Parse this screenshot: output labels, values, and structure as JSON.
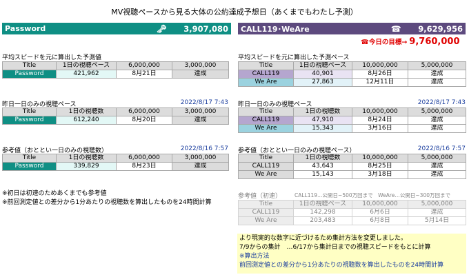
{
  "title": "MV視聴ペースから見る大体の公約達成予想日（あくまでもわたし予測）",
  "password_header": {
    "name": "Password",
    "icon": "🗝",
    "count": "3,907,080"
  },
  "call_header": {
    "name": "CALL119･WeAre",
    "icon": "☎",
    "count": "9,629,956"
  },
  "goal": {
    "label": "☎今日の目標→",
    "value": "9,760,000"
  },
  "left": {
    "avg": {
      "title": "平均スピードを元に算出した予測値",
      "columns": [
        "Title",
        "1日の視聴ペース",
        "6,000,000",
        "3,000,000"
      ],
      "rows": [
        {
          "label": "Password",
          "pace": "421,962",
          "d1": "8月21日",
          "d2": "達成"
        }
      ]
    },
    "yesterday": {
      "title": "昨日一日のみの視聴ペース",
      "date": "2022/8/17 7:43",
      "columns": [
        "Title",
        "1日の視聴数",
        "6,000,000",
        "3,000,000"
      ],
      "rows": [
        {
          "label": "Password",
          "pace": "612,240",
          "d1": "8月20日",
          "d2": "達成"
        }
      ]
    },
    "reference": {
      "title": "参考値（おととい一日のみの視聴数）",
      "date": "2022/8/16 7:57",
      "columns": [
        "Title",
        "1日の視聴数",
        "6,000,000",
        "3,000,000"
      ],
      "rows": [
        {
          "label": "Password",
          "pace": "339,829",
          "d1": "8月23日",
          "d2": "達成"
        }
      ]
    },
    "notes": [
      "※初日は初速のためあくまでも参考値",
      "※前回測定値との差分から1分あたりの視聴数を算出したものを24時間計算"
    ]
  },
  "right": {
    "avg": {
      "title": "平均スピードを元に算出した予測ペース",
      "columns": [
        "Title",
        "1日の視聴ペース",
        "10,000,000",
        "5,000,000"
      ],
      "rows": [
        {
          "label": "CALL119",
          "pace": "40,901",
          "d1": "8月26日",
          "d2": "達成"
        },
        {
          "label": "We Are",
          "pace": "27,863",
          "d1": "12月11日",
          "d2": "達成"
        }
      ]
    },
    "yesterday": {
      "title": "昨日一日のみの視聴ペース",
      "date": "2022/8/17 7:43",
      "columns": [
        "Title",
        "1日の視聴数",
        "10,000,000",
        "5,000,000"
      ],
      "rows": [
        {
          "label": "CALL119",
          "pace": "47,910",
          "d1": "8月24日",
          "d2": "達成"
        },
        {
          "label": "We Are",
          "pace": "15,343",
          "d1": "3月16日",
          "d2": "達成"
        }
      ]
    },
    "reference": {
      "title": "参考値（おととい一日のみの視聴ペース）",
      "date": "2022/8/16 7:57",
      "columns": [
        "Title",
        "1日の視聴数",
        "10,000,000",
        "5,000,000"
      ],
      "rows": [
        {
          "label": "CALL119",
          "pace": "43,643",
          "d1": "8月25日",
          "d2": "達成"
        },
        {
          "label": "We Are",
          "pace": "15,143",
          "d1": "3月18日",
          "d2": "達成"
        }
      ]
    },
    "initial": {
      "title": "参考値（初速）",
      "note": "CALL119…公開日~500万回まで　WeAre…公開日~300万回まで",
      "columns": [
        "Title",
        "1日の視聴ペース",
        "10,000,000",
        "5,000,000"
      ],
      "rows": [
        {
          "label": "CALL119",
          "pace": "142,298",
          "d1": "6月6日",
          "d2": "達成"
        },
        {
          "label": "We Are",
          "pace": "203,483",
          "d1": "6月8日",
          "d2": "5月14日"
        }
      ]
    },
    "info": [
      "より現実的な数字に近づけるため集計方法を変更しました。",
      "7/9からの集計　…6/17から集計日までの視聴スピードをもとに計算",
      "※算出方法",
      "前回測定値との差分から1分あたりの視聴数を算出したものを24時間計算"
    ]
  },
  "colors": {
    "teal": "#0f8f84",
    "purple": "#5d4a7e",
    "goal_red": "#e00000",
    "date_blue": "#1a3d9e"
  }
}
